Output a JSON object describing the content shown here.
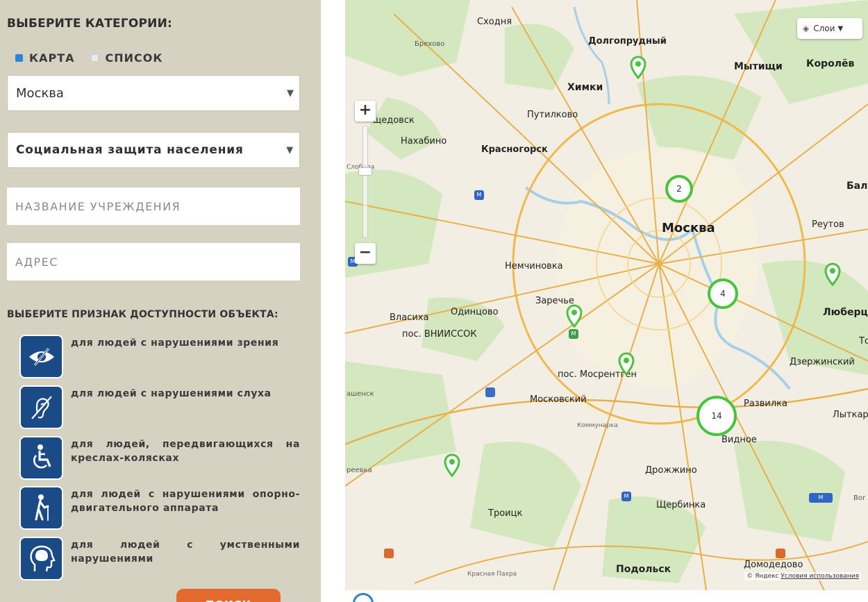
{
  "filters": {
    "heading": "ВЫБЕРИТЕ КАТЕГОРИИ:",
    "view_options": [
      {
        "label": "КАРТА",
        "selected": true
      },
      {
        "label": "СПИСОК",
        "selected": false
      }
    ],
    "city_select": {
      "value": "Москва"
    },
    "category_select": {
      "value": "Социальная защита населения"
    },
    "name_input": {
      "placeholder": "НАЗВАНИЕ УЧРЕЖДЕНИЯ",
      "value": ""
    },
    "address_input": {
      "placeholder": "АДРЕС",
      "value": ""
    },
    "accessibility_heading": "ВЫБЕРИТЕ ПРИЗНАК ДОСТУПНОСТИ ОБЪЕКТА:",
    "accessibility_options": [
      {
        "icon": "eye-crossed-icon",
        "label": "для людей с нарушениями зрения"
      },
      {
        "icon": "ear-crossed-icon",
        "label": "для людей с нарушениями слуха"
      },
      {
        "icon": "wheelchair-icon",
        "label": "для людей, передвигающихся на креслах-колясках"
      },
      {
        "icon": "walking-cane-icon",
        "label": "для людей с нарушениями опорно-двигательного аппарата"
      },
      {
        "icon": "head-brain-icon",
        "label": "для людей с умственными нарушениями"
      }
    ],
    "search_label": "ПОИСК"
  },
  "map": {
    "layers_label": "Слои",
    "zoom_in_label": "+",
    "zoom_out_label": "−",
    "clusters": [
      {
        "count": "2"
      },
      {
        "count": "4"
      },
      {
        "count": "14"
      }
    ],
    "places": [
      "Сходня",
      "Брехово",
      "Долгопрудный",
      "Мытищи",
      "Королёв",
      "Химки",
      "Путилково",
      "щедовск",
      "Нахабино",
      "Красногорск",
      "Слобода",
      "Москва",
      "Реутов",
      "Бал",
      "Немчиновка",
      "Заречье",
      "Власиха",
      "Одинцово",
      "пос. ВНИИССОК",
      "Люберцы",
      "То",
      "Дзержинский",
      "пос. Мосрентген",
      "ашенск",
      "Московский",
      "Развилка",
      "Лыткар",
      "Коммунарка",
      "Видное",
      "реевка",
      "Дрожжино",
      "Щербинка",
      "Троицк",
      "Bor",
      "Подольск",
      "Домодедово",
      "Красная Пахра"
    ],
    "pins": 6,
    "copyright_prefix": "© Яндекс",
    "terms_link": "Условия использования",
    "accent_color": "#47c33c"
  }
}
